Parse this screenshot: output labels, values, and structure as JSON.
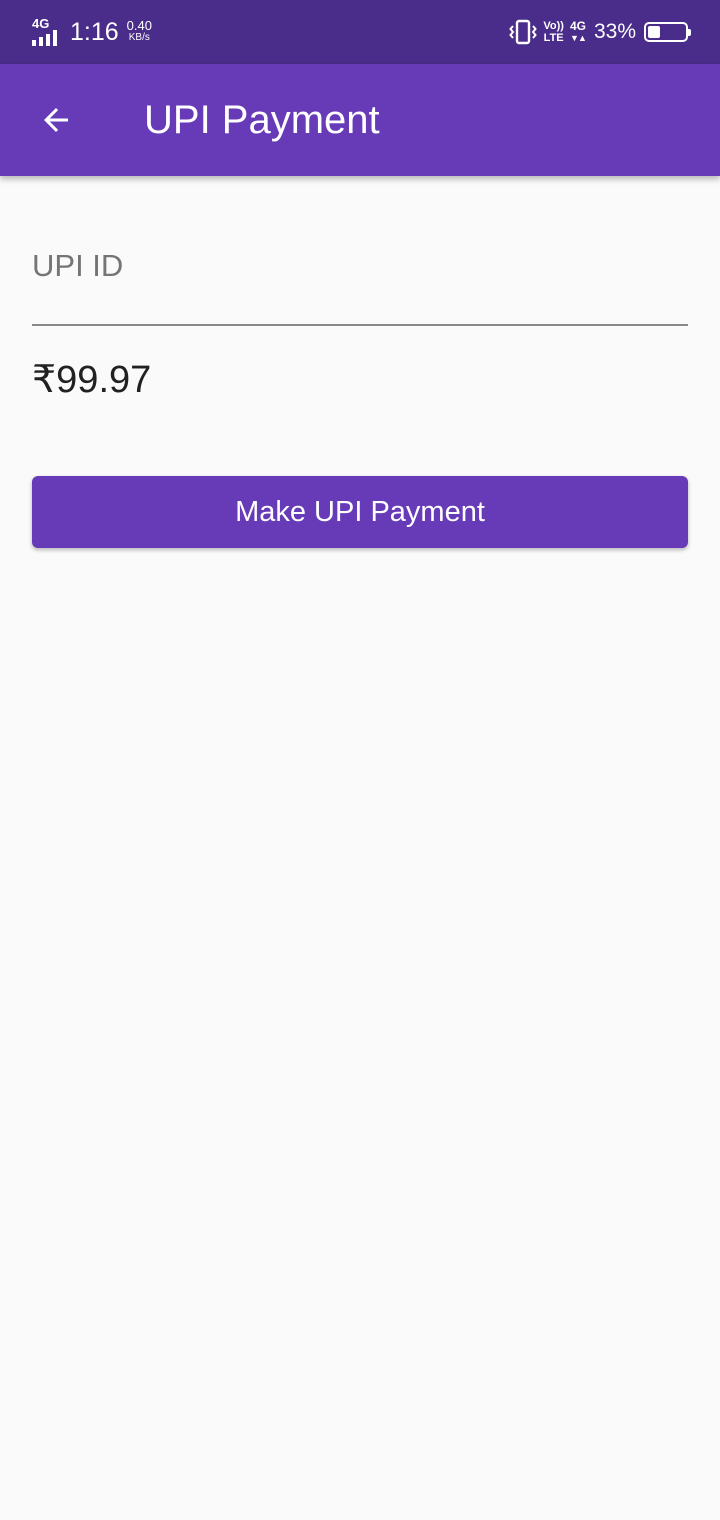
{
  "status_bar": {
    "network_left": "4G",
    "time": "1:16",
    "speed_value": "0.40",
    "speed_unit": "KB/s",
    "volte_top": "Vo))",
    "volte_bottom": "LTE",
    "network_right": "4G",
    "network_right_arrows": "▼▲",
    "battery_percent_text": "33%",
    "battery_level": 0.33
  },
  "app_bar": {
    "title": "UPI Payment",
    "back_icon": "arrow-back-icon",
    "background_color": "#673ab7"
  },
  "form": {
    "upi_id_placeholder": "UPI ID",
    "upi_id_value": "",
    "amount": "₹99.97",
    "pay_button_label": "Make UPI Payment"
  },
  "colors": {
    "status_bar": "#4a2c8a",
    "accent": "#673ab7",
    "background": "#fafafa"
  }
}
